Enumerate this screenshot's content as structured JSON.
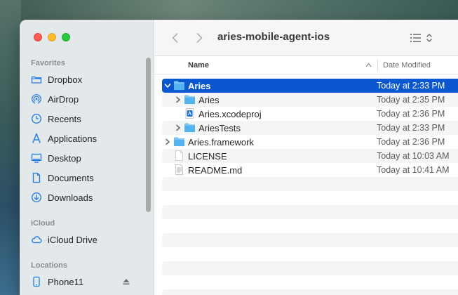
{
  "window": {
    "title": "aries-mobile-agent-ios"
  },
  "sidebar": {
    "favorites_header": "Favorites",
    "favorites": [
      {
        "label": "Dropbox",
        "icon": "dropbox-folder-icon"
      },
      {
        "label": "AirDrop",
        "icon": "airdrop-icon"
      },
      {
        "label": "Recents",
        "icon": "clock-icon"
      },
      {
        "label": "Applications",
        "icon": "applications-icon"
      },
      {
        "label": "Desktop",
        "icon": "desktop-icon"
      },
      {
        "label": "Documents",
        "icon": "document-icon"
      },
      {
        "label": "Downloads",
        "icon": "download-icon"
      }
    ],
    "icloud_header": "iCloud",
    "icloud": [
      {
        "label": "iCloud Drive",
        "icon": "cloud-icon"
      }
    ],
    "locations_header": "Locations",
    "locations": [
      {
        "label": "Phone11",
        "icon": "phone-icon"
      }
    ]
  },
  "columns": {
    "name": "Name",
    "date": "Date Modified"
  },
  "files": [
    {
      "name": "Aries",
      "date": "Today at 2:33 PM",
      "kind": "folder",
      "expanded": true,
      "selected": true,
      "level": 0
    },
    {
      "name": "Aries",
      "date": "Today at 2:35 PM",
      "kind": "folder",
      "expanded": false,
      "selected": false,
      "level": 1
    },
    {
      "name": "Aries.xcodeproj",
      "date": "Today at 2:36 PM",
      "kind": "xcodeproj",
      "selected": false,
      "level": 1
    },
    {
      "name": "AriesTests",
      "date": "Today at 2:33 PM",
      "kind": "folder",
      "expanded": false,
      "selected": false,
      "level": 1
    },
    {
      "name": "Aries.framework",
      "date": "Today at 2:36 PM",
      "kind": "folder",
      "expanded": false,
      "selected": false,
      "level": 0
    },
    {
      "name": "LICENSE",
      "date": "Today at 10:03 AM",
      "kind": "file",
      "selected": false,
      "level": 0
    },
    {
      "name": "README.md",
      "date": "Today at 10:41 AM",
      "kind": "text-file",
      "selected": false,
      "level": 0
    }
  ],
  "colors": {
    "accent": "#0b57d0",
    "folder": "#54b3f0",
    "sidebar_icon": "#1f7ae0"
  }
}
